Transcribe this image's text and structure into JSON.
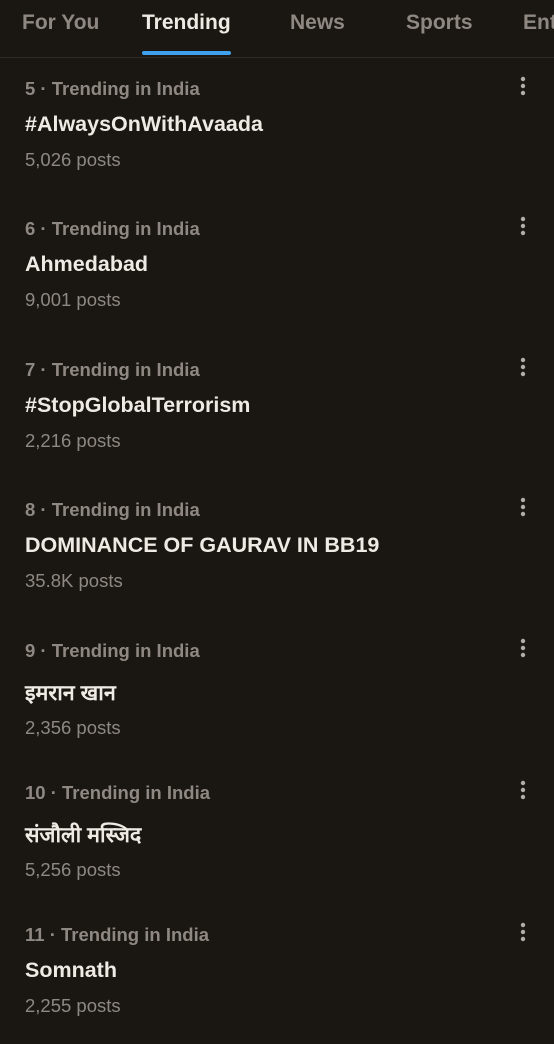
{
  "tabs": [
    {
      "label": "For You",
      "active": false
    },
    {
      "label": "Trending",
      "active": true
    },
    {
      "label": "News",
      "active": false
    },
    {
      "label": "Sports",
      "active": false
    },
    {
      "label": "Ent",
      "active": false
    }
  ],
  "colors": {
    "background": "#1a1612",
    "accent": "#3fa0ee",
    "text_primary": "#efeae4",
    "text_secondary": "#8f8882"
  },
  "trends": [
    {
      "meta": "5 · Trending in India",
      "title": "#AlwaysOnWithAvaada",
      "posts": "5,026 posts"
    },
    {
      "meta": "6 · Trending in India",
      "title": "Ahmedabad",
      "posts": "9,001 posts"
    },
    {
      "meta": "7 · Trending in India",
      "title": "#StopGlobalTerrorism",
      "posts": "2,216 posts"
    },
    {
      "meta": "8 · Trending in India",
      "title": "DOMINANCE OF GAURAV IN BB19",
      "posts": "35.8K posts"
    },
    {
      "meta": "9 · Trending in India",
      "title": "इमरान खान",
      "posts": "2,356 posts"
    },
    {
      "meta": "10 · Trending in India",
      "title": "संजौली मस्जिद",
      "posts": "5,256 posts"
    },
    {
      "meta": "11 · Trending in India",
      "title": "Somnath",
      "posts": "2,255 posts"
    }
  ],
  "more_icon": "more-vertical-icon"
}
